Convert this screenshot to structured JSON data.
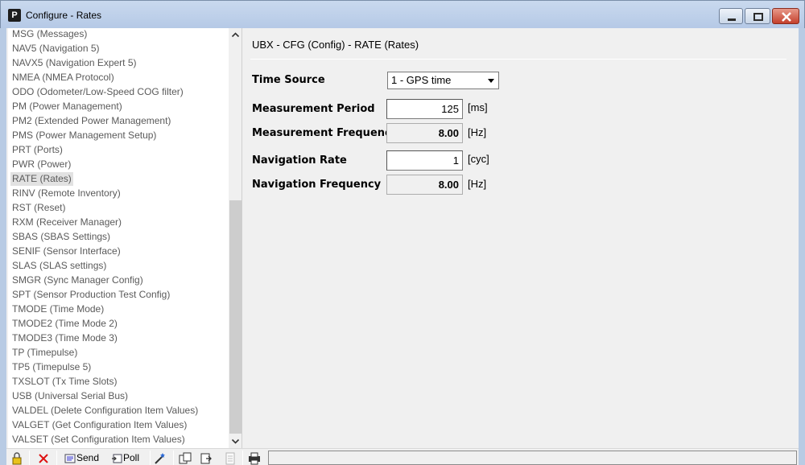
{
  "window": {
    "app_icon_letter": "P",
    "title": "Configure - Rates"
  },
  "message_list": {
    "items": [
      "MSG (Messages)",
      "NAV5 (Navigation 5)",
      "NAVX5 (Navigation Expert 5)",
      "NMEA (NMEA Protocol)",
      "ODO (Odometer/Low-Speed COG filter)",
      "PM (Power Management)",
      "PM2 (Extended Power Management)",
      "PMS (Power Management Setup)",
      "PRT (Ports)",
      "PWR (Power)",
      "RATE (Rates)",
      "RINV (Remote Inventory)",
      "RST (Reset)",
      "RXM (Receiver Manager)",
      "SBAS (SBAS Settings)",
      "SENIF (Sensor Interface)",
      "SLAS (SLAS settings)",
      "SMGR (Sync Manager Config)",
      "SPT (Sensor Production Test Config)",
      "TMODE (Time Mode)",
      "TMODE2 (Time Mode 2)",
      "TMODE3 (Time Mode 3)",
      "TP (Timepulse)",
      "TP5 (Timepulse 5)",
      "TXSLOT (Tx Time Slots)",
      "USB (Universal Serial Bus)",
      "VALDEL (Delete Configuration Item Values)",
      "VALGET (Get Configuration Item Values)",
      "VALSET (Set Configuration Item Values)"
    ],
    "selected": "RATE (Rates)"
  },
  "panel": {
    "header": "UBX - CFG (Config) - RATE (Rates)",
    "time_source": {
      "label": "Time Source",
      "value": "1 - GPS time"
    },
    "measurement_period": {
      "label": "Measurement Period",
      "value": "125",
      "unit": "[ms]"
    },
    "measurement_frequency": {
      "label": "Measurement Frequency",
      "value": "8.00",
      "unit": "[Hz]"
    },
    "navigation_rate": {
      "label": "Navigation Rate",
      "value": "1",
      "unit": "[cyc]"
    },
    "navigation_frequency": {
      "label": "Navigation Frequency",
      "value": "8.00",
      "unit": "[Hz]"
    }
  },
  "toolbar": {
    "send_label": "Send",
    "poll_label": "Poll",
    "status_text": ""
  },
  "colors": {
    "title_bar": "#c9d9ee",
    "close_button": "#c4402c",
    "list_text": "#5a5a5a",
    "selected_row": "#e2e2e2"
  }
}
